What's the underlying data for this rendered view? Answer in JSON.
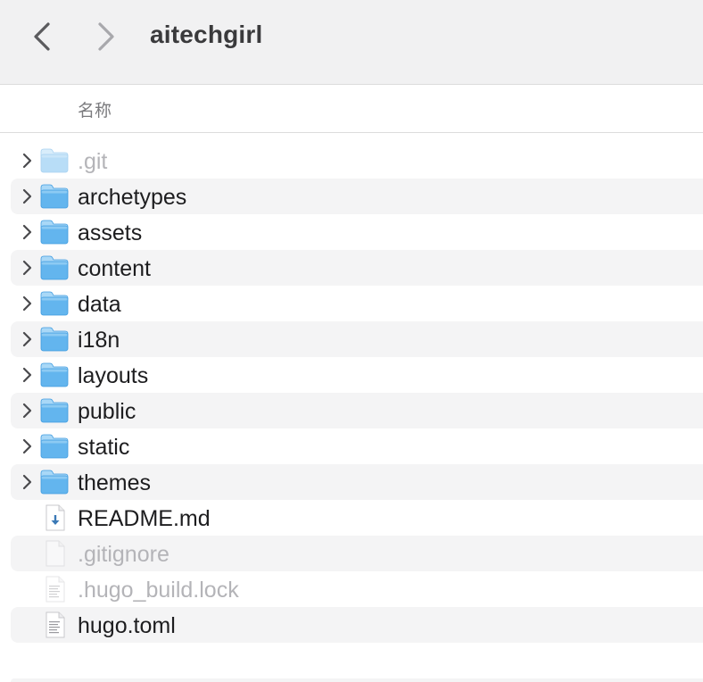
{
  "window": {
    "title": "aitechgirl"
  },
  "header": {
    "name_column": "名称"
  },
  "files": [
    {
      "name": ".git",
      "type": "folder",
      "dimmed": true,
      "expandable": true,
      "icon": "folder-icon"
    },
    {
      "name": "archetypes",
      "type": "folder",
      "dimmed": false,
      "expandable": true,
      "icon": "folder-icon"
    },
    {
      "name": "assets",
      "type": "folder",
      "dimmed": false,
      "expandable": true,
      "icon": "folder-icon"
    },
    {
      "name": "content",
      "type": "folder",
      "dimmed": false,
      "expandable": true,
      "icon": "folder-icon"
    },
    {
      "name": "data",
      "type": "folder",
      "dimmed": false,
      "expandable": true,
      "icon": "folder-icon"
    },
    {
      "name": "i18n",
      "type": "folder",
      "dimmed": false,
      "expandable": true,
      "icon": "folder-icon"
    },
    {
      "name": "layouts",
      "type": "folder",
      "dimmed": false,
      "expandable": true,
      "icon": "folder-icon"
    },
    {
      "name": "public",
      "type": "folder",
      "dimmed": false,
      "expandable": true,
      "icon": "folder-icon"
    },
    {
      "name": "static",
      "type": "folder",
      "dimmed": false,
      "expandable": true,
      "icon": "folder-icon"
    },
    {
      "name": "themes",
      "type": "folder",
      "dimmed": false,
      "expandable": true,
      "icon": "folder-icon"
    },
    {
      "name": "README.md",
      "type": "markdown",
      "dimmed": false,
      "expandable": false,
      "icon": "markdown-file-icon"
    },
    {
      "name": ".gitignore",
      "type": "blank",
      "dimmed": true,
      "expandable": false,
      "icon": "blank-file-icon"
    },
    {
      "name": ".hugo_build.lock",
      "type": "text",
      "dimmed": true,
      "expandable": false,
      "icon": "text-file-icon"
    },
    {
      "name": "hugo.toml",
      "type": "text",
      "dimmed": false,
      "expandable": false,
      "icon": "text-file-icon"
    }
  ],
  "colors": {
    "folder_top": "#a9d8f7",
    "folder_body": "#63b5ee",
    "folder_edge": "#3f9be0",
    "row_alt": "#f4f4f5",
    "dim_text": "#b4b4b8"
  }
}
